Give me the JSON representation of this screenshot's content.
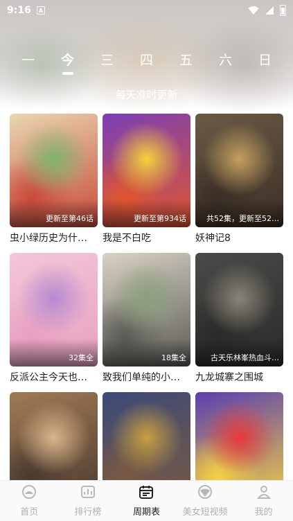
{
  "status_bar": {
    "time": "9:16",
    "app_icon": "A"
  },
  "weekdays": [
    {
      "label": "一",
      "active": false
    },
    {
      "label": "今",
      "active": true
    },
    {
      "label": "三",
      "active": false
    },
    {
      "label": "四",
      "active": false
    },
    {
      "label": "五",
      "active": false
    },
    {
      "label": "六",
      "active": false
    },
    {
      "label": "日",
      "active": false
    }
  ],
  "subtitle": "每天准时更新",
  "cards": [
    {
      "title": "虫小绿历史为什…",
      "badge": "更新至第46话",
      "colors": [
        "#e8d6b0",
        "#7db36a",
        "#c94a3a"
      ]
    },
    {
      "title": "我是不白吃",
      "badge": "更新至第934话",
      "colors": [
        "#7b3fb5",
        "#f5d33a",
        "#e0562d"
      ]
    },
    {
      "title": "妖神记8",
      "badge": "共52集，更新至52…",
      "colors": [
        "#6a5a45",
        "#c4a060",
        "#3a2e25"
      ]
    },
    {
      "title": "反派公主今天也…",
      "badge": "32集全",
      "colors": [
        "#f3c6d8",
        "#b58ad0",
        "#e8a0c0"
      ]
    },
    {
      "title": "致我们单纯的小…",
      "badge": "18集全",
      "colors": [
        "#d9d2c5",
        "#8aa07a",
        "#5a5a55"
      ]
    },
    {
      "title": "九龙城寨之围城",
      "badge": "古天乐林峯热血斗…",
      "colors": [
        "#4a4a48",
        "#8a8478",
        "#2a2a28"
      ]
    },
    {
      "title": "",
      "badge": "",
      "colors": [
        "#a07a55",
        "#d8b58a",
        "#4a3a2e"
      ]
    },
    {
      "title": "",
      "badge": "",
      "colors": [
        "#3c4a78",
        "#c8a040",
        "#7a5a40"
      ]
    },
    {
      "title": "",
      "badge": "",
      "colors": [
        "#5a3fb0",
        "#e83a3a",
        "#f5d040"
      ]
    }
  ],
  "tab_bar": [
    {
      "label": "首页",
      "icon": "home-icon",
      "active": false
    },
    {
      "label": "排行榜",
      "icon": "ranking-icon",
      "active": false
    },
    {
      "label": "周期表",
      "icon": "calendar-icon",
      "active": true
    },
    {
      "label": "美女短视频",
      "icon": "short-video-icon",
      "active": false
    },
    {
      "label": "我的",
      "icon": "profile-icon",
      "active": false
    }
  ]
}
